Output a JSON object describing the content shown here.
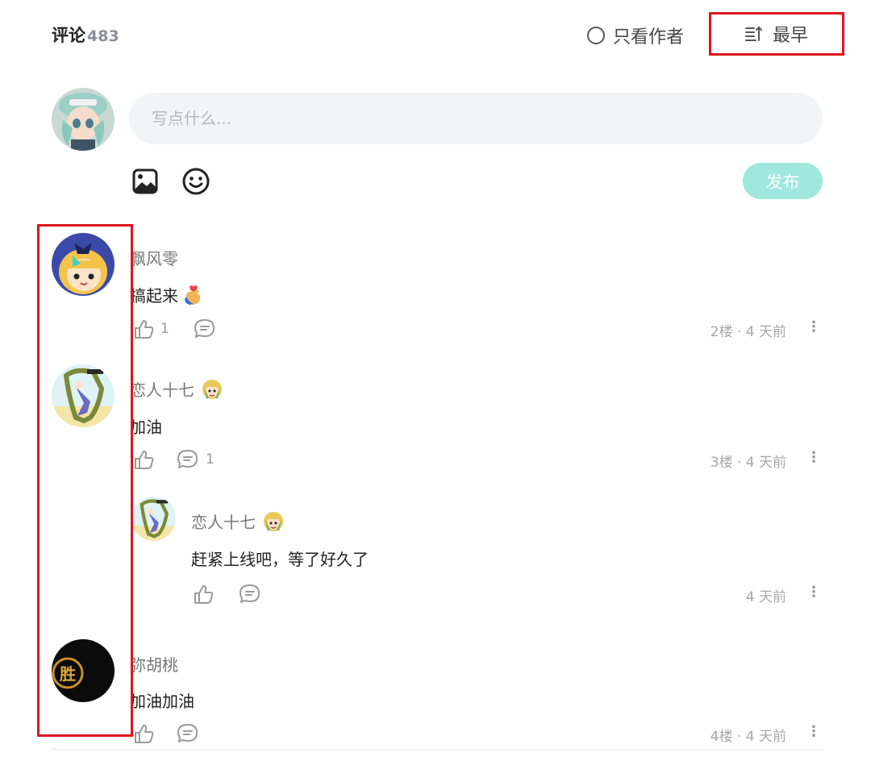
{
  "header": {
    "title": "评论",
    "count": "483",
    "author_only_label": "只看作者",
    "sort_label": "最早"
  },
  "composer": {
    "placeholder": "写点什么...",
    "publish_label": "发布"
  },
  "comments": [
    {
      "user": "飘风零",
      "text": "搞起来",
      "likes": "1",
      "replies": "",
      "meta": "2楼 · 4 天前"
    },
    {
      "user": "恋人十七",
      "text": "加油",
      "likes": "",
      "replies": "1",
      "meta": "3楼 · 4 天前",
      "reply": {
        "user": "恋人十七",
        "text": "赶紧上线吧，等了好久了",
        "meta": "4 天前"
      }
    },
    {
      "user": "弥胡桃",
      "text": "加油加油",
      "likes": "",
      "replies": "",
      "meta": "4楼 · 4 天前"
    }
  ],
  "avatar_badge_text": "胜",
  "more_glyph": "⋮",
  "colors": {
    "accent": "#9ee8dd",
    "highlight": "#e0141e",
    "input_bg": "#f3f4f6"
  },
  "icons": [
    "image-icon",
    "emoji-icon",
    "sort-icon",
    "like-icon",
    "reply-icon",
    "more-icon",
    "heart-hand-emoji",
    "girl-emoji"
  ]
}
